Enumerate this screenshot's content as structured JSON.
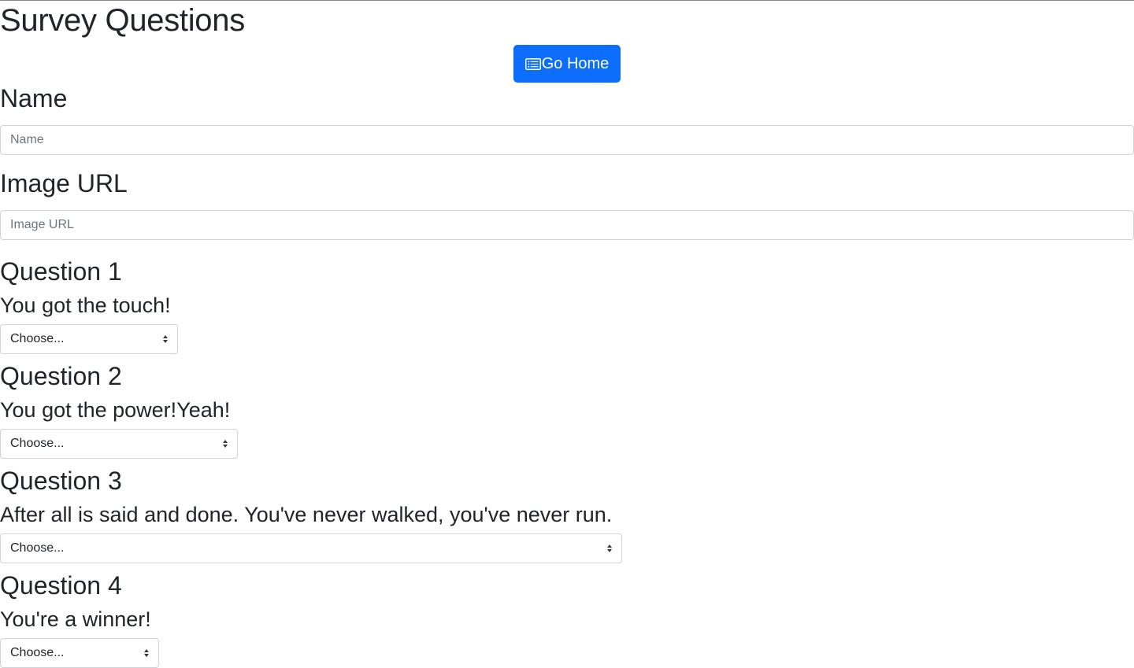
{
  "page": {
    "title": "Survey Questions"
  },
  "toolbar": {
    "home_label": "Go Home",
    "home_icon": "list-alt-icon"
  },
  "form": {
    "name": {
      "label": "Name",
      "placeholder": "Name",
      "value": ""
    },
    "image": {
      "label": "Image URL",
      "placeholder": "Image URL",
      "value": ""
    }
  },
  "questions": [
    {
      "heading": "Question 1",
      "text": "You got the touch!",
      "selected": "Choose..."
    },
    {
      "heading": "Question 2",
      "text": "You got the power!Yeah!",
      "selected": "Choose..."
    },
    {
      "heading": "Question 3",
      "text": "After all is said and done. You've never walked, you've never run.",
      "selected": "Choose..."
    },
    {
      "heading": "Question 4",
      "text": "You're a winner!",
      "selected": "Choose..."
    }
  ],
  "colors": {
    "primary": "#0d6efd",
    "text": "#212529",
    "border": "#ced4da",
    "placeholder": "#6c757d"
  }
}
